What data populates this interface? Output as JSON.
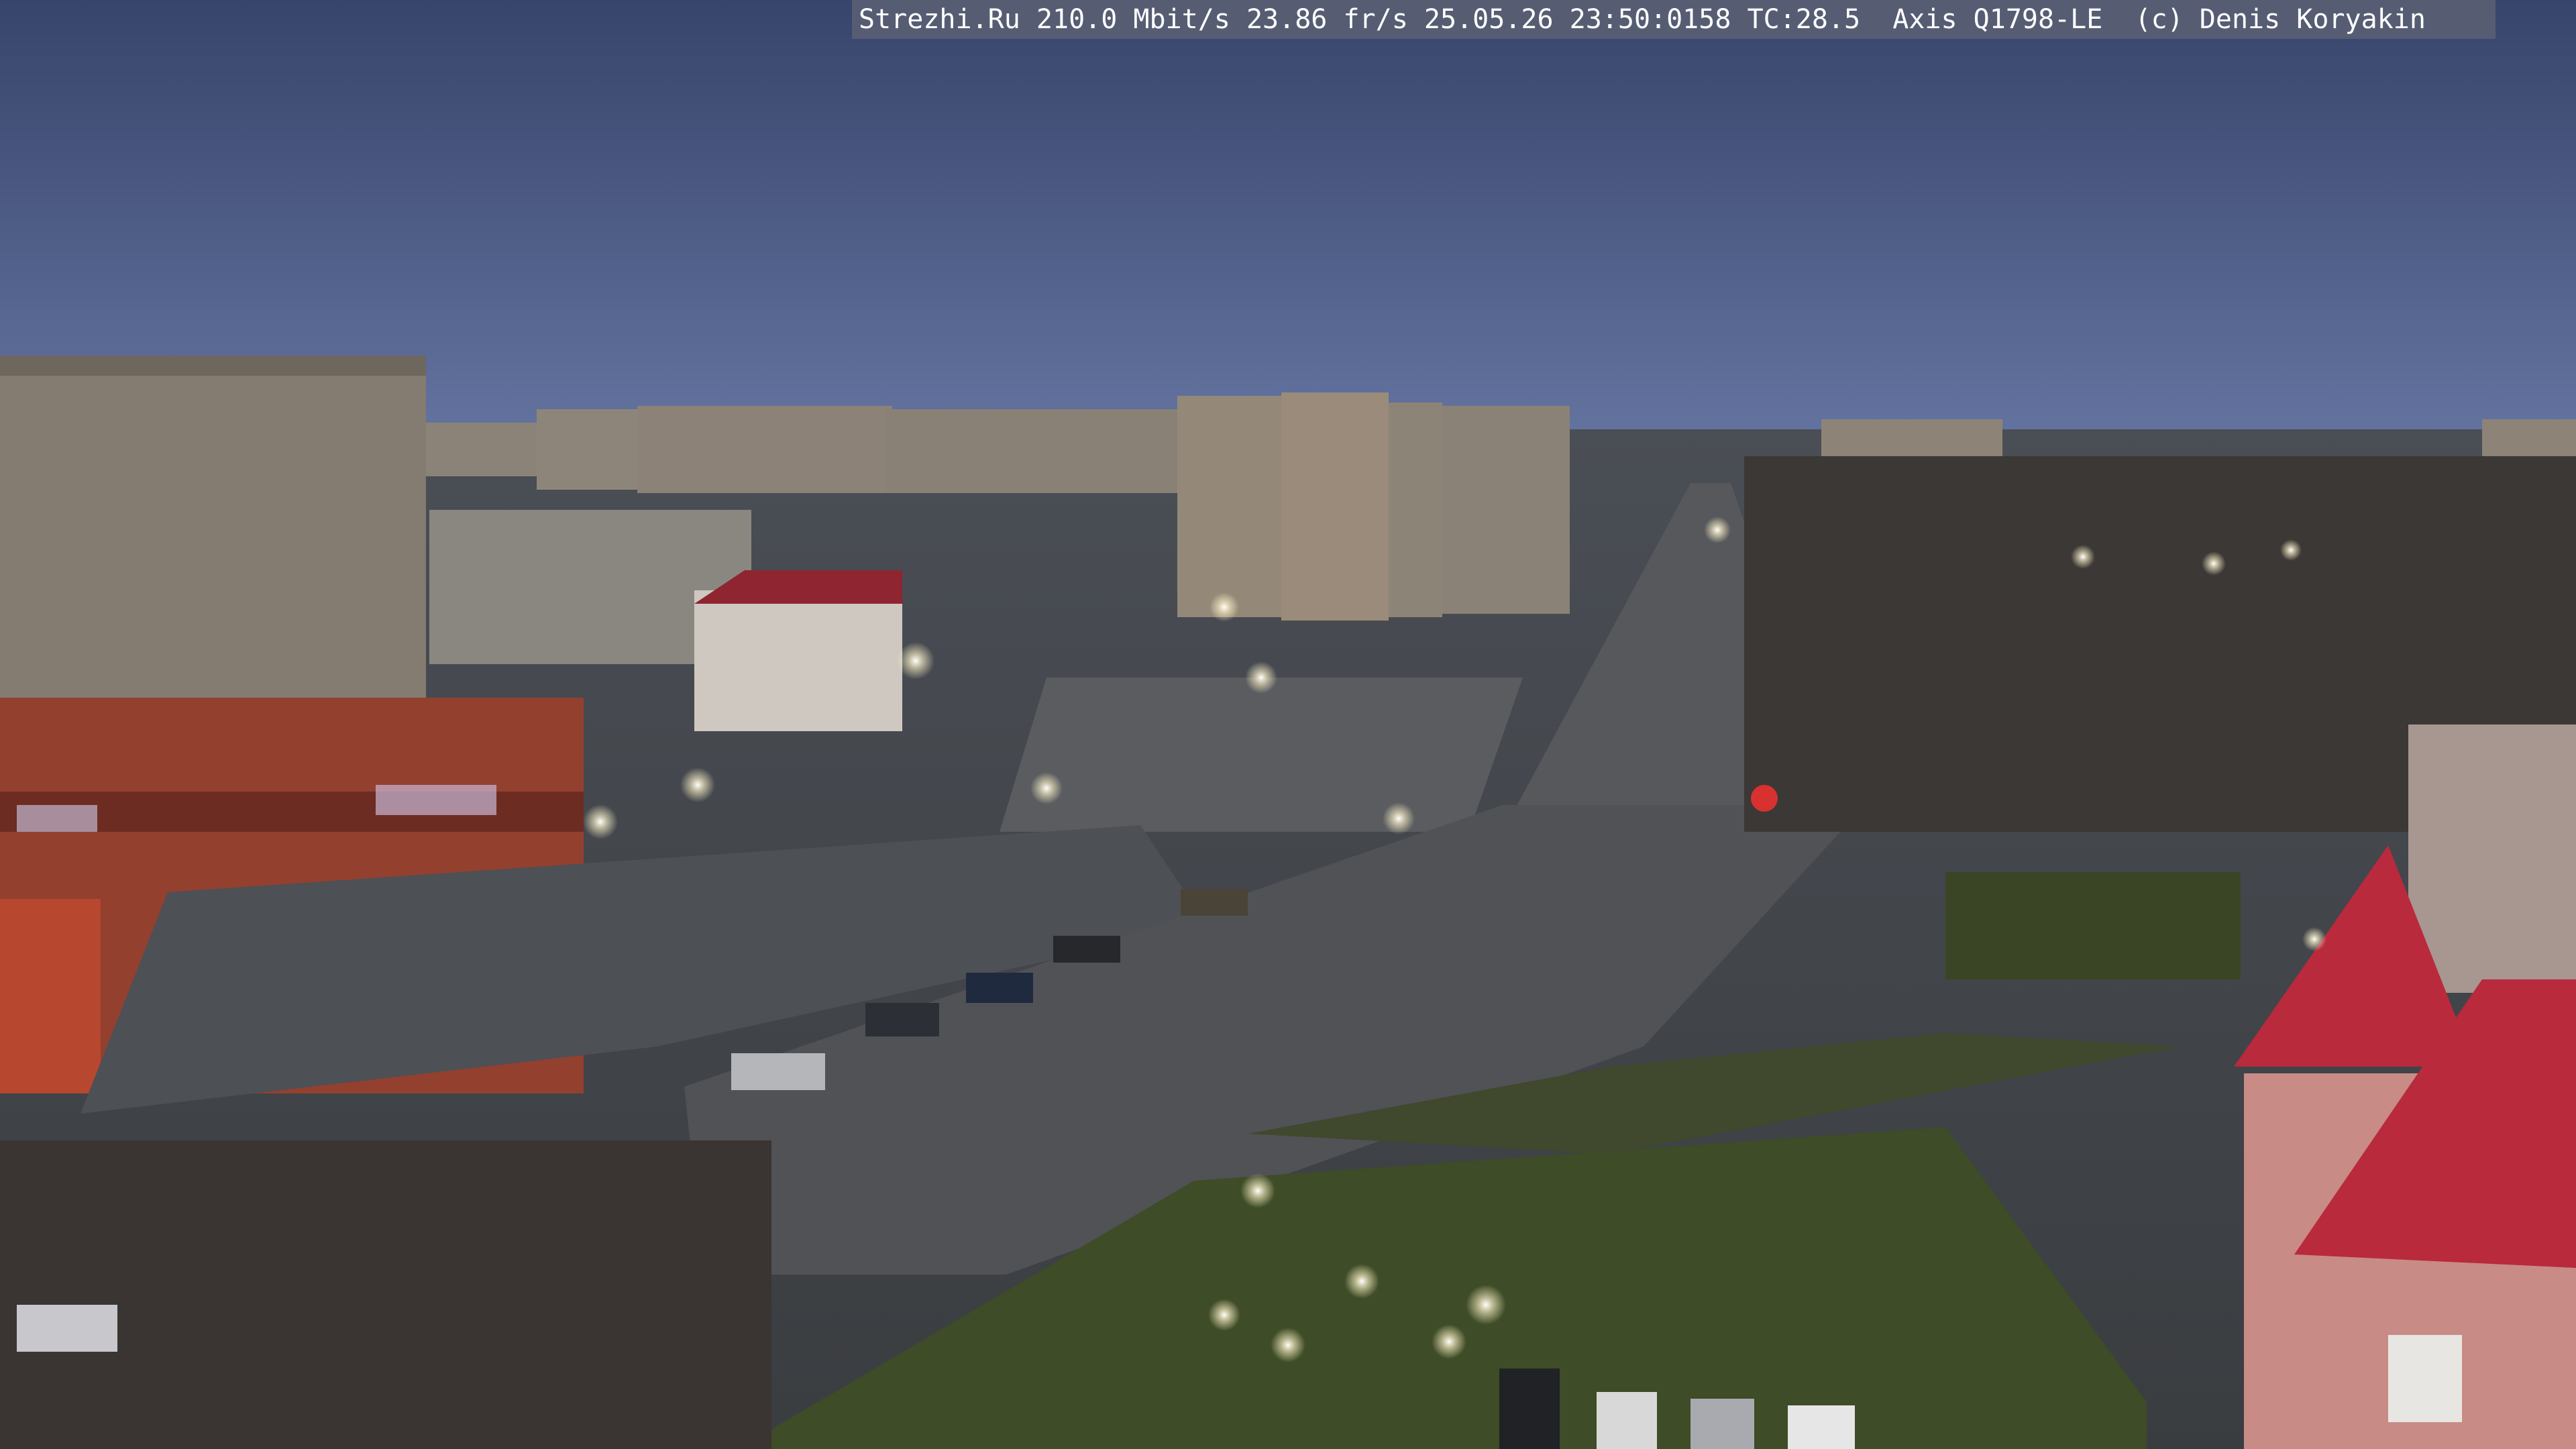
{
  "overlay": {
    "text": "Strezhi.Ru 210.0 Mbit/s 23.86 fr/s 25.05.26 23:50:0158 TC:28.5  Axis Q1798-LE  (c) Denis Koryakin"
  },
  "scene": {
    "description_tag": "city-square-webcam-dusk",
    "colors": {
      "sky_top": "#3c4a72",
      "sky_bottom": "#5e6f9a",
      "road": "#57595c",
      "grass": "#3d4a28",
      "facade_red": "#9c3a2a",
      "panel_block": "#8a8178",
      "roof_red": "#b8283a"
    }
  }
}
